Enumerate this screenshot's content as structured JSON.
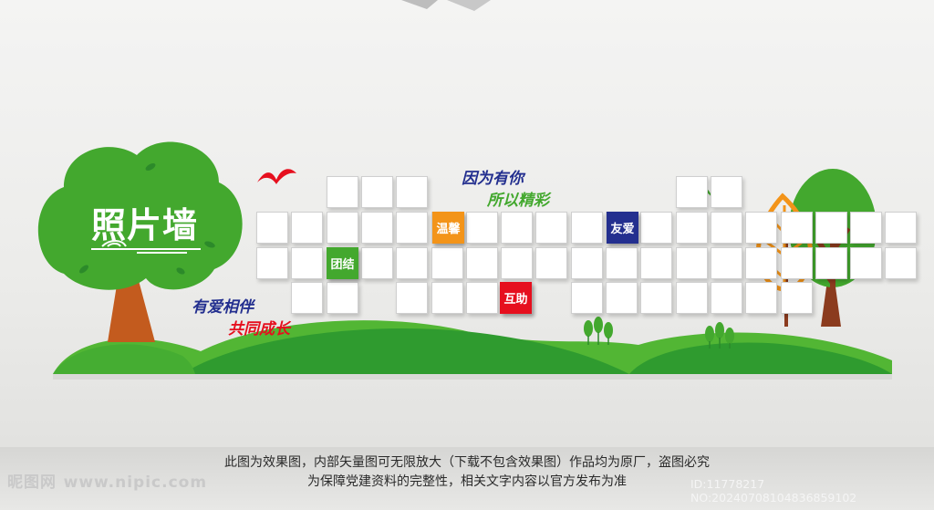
{
  "wall": {
    "title": "照片墙",
    "slogan_top_1": "因为有你",
    "slogan_top_2": "所以精彩",
    "slogan_left_1": "有爱相伴",
    "slogan_left_2": "共同成长"
  },
  "tags": {
    "tuanjie": "团结",
    "wenxin": "温馨",
    "huzhu": "互助",
    "youai": "友爱"
  },
  "colors": {
    "green": "#43a82e",
    "dark_green": "#2c8a2a",
    "orange": "#f39419",
    "red": "#e60f1e",
    "navy": "#232f8f",
    "trunk": "#c35b1e"
  },
  "caption": {
    "line1": "此图为效果图，内部矢量图可无限放大（下载不包含效果图）作品均为原厂，盗图必究",
    "line2": "为保障党建资料的完整性，相关文字内容以官方发布为准"
  },
  "watermark": {
    "site_name": "昵图网",
    "site_url": "www.nipic.com"
  },
  "meta": {
    "id_text": "ID:11778217 NO:20240708104836859102"
  }
}
